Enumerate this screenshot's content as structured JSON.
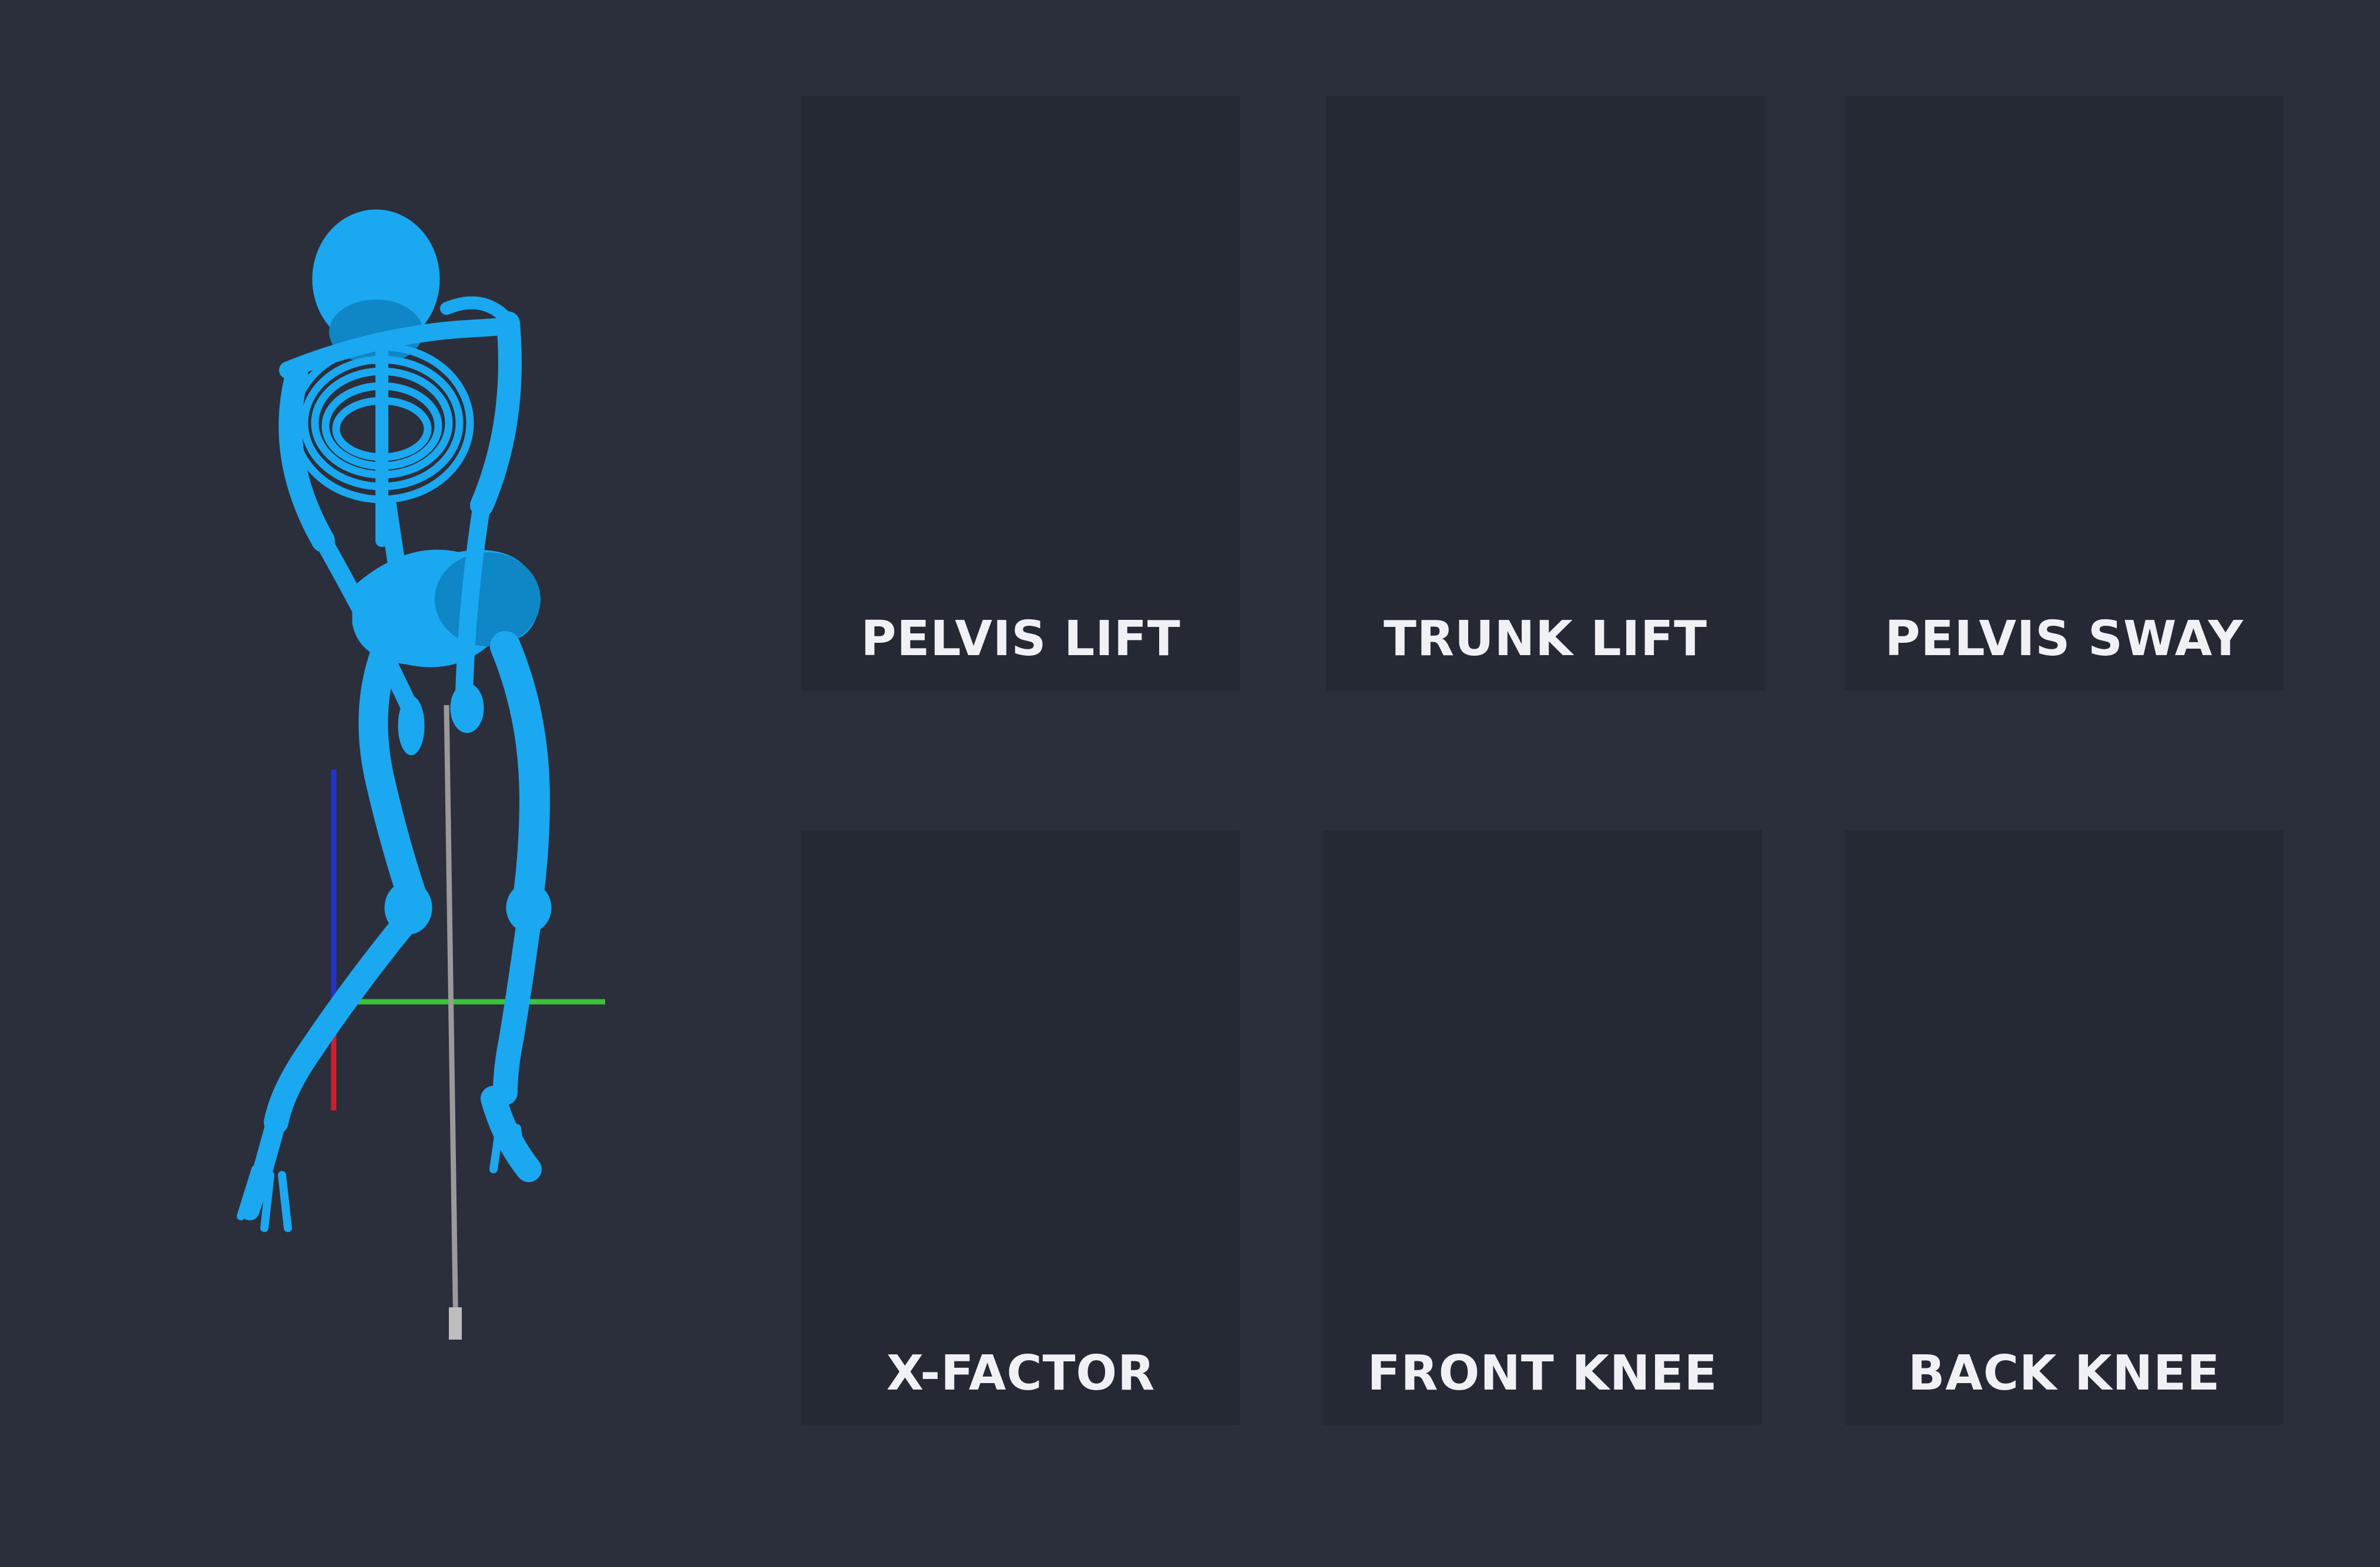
{
  "colors": {
    "background": "#2a2f3b",
    "tile": "#252934",
    "label": "#f0f1f4",
    "skeleton": "#1aa8f0",
    "skeleton_shade": "#0f86c6",
    "axis_x": "#d21e2a",
    "axis_y": "#3ac43a",
    "axis_z": "#2233cc",
    "club": "#9a9a9a"
  },
  "viewport": {
    "model": "skeleton-golf-pose",
    "axes_icon": "xyz-axes-gizmo"
  },
  "metrics": [
    {
      "label": "PELVIS LIFT"
    },
    {
      "label": "TRUNK LIFT"
    },
    {
      "label": "PELVIS SWAY"
    },
    {
      "label": "X-FACTOR"
    },
    {
      "label": "FRONT KNEE"
    },
    {
      "label": "BACK KNEE"
    }
  ]
}
